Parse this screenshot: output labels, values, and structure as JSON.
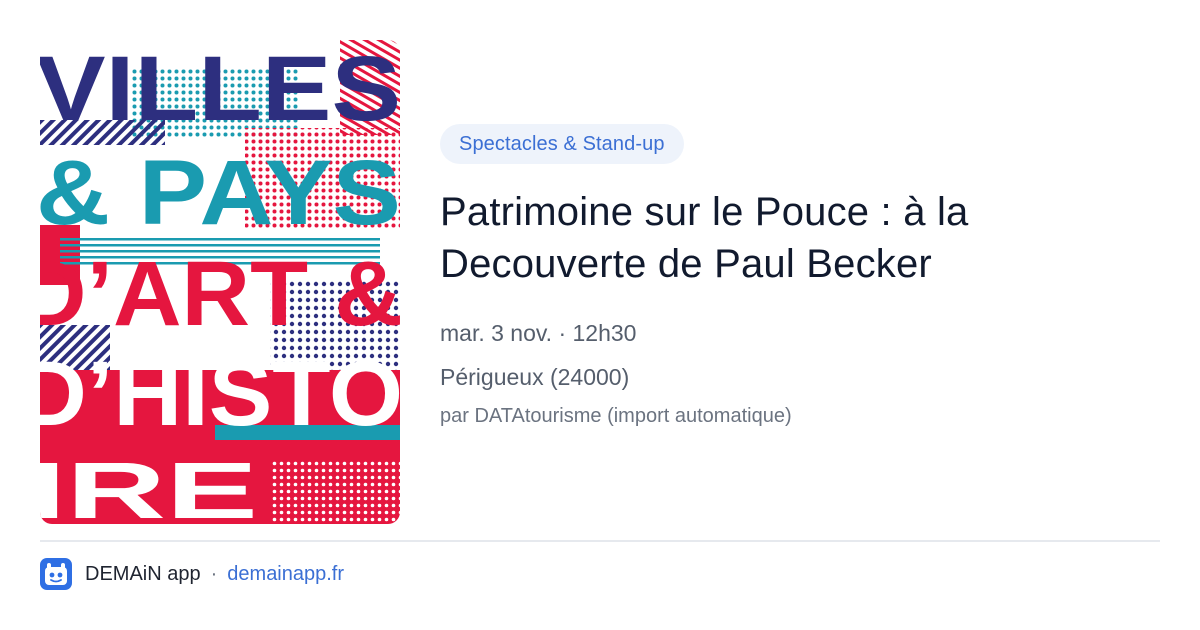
{
  "image": {
    "poster_text": [
      "VILLES",
      "& PAYS",
      "D’ART &",
      "D’HISTO",
      "IRE"
    ],
    "colors": {
      "navy": "#2d2f7f",
      "teal": "#1a9bb0",
      "red": "#e5163f",
      "white": "#ffffff"
    }
  },
  "event": {
    "category": "Spectacles & Stand-up",
    "title": "Patrimoine sur le Pouce : à la Decouverte de Paul Becker",
    "datetime": "mar. 3 nov. · 12h30",
    "location": "Périgueux (24000)",
    "source": "par DATAtourisme (import automatique)"
  },
  "footer": {
    "app_name": "DEMAiN app",
    "separator": "·",
    "site": "demainapp.fr",
    "logo_icon": "demain-logo-icon"
  },
  "colors": {
    "accent": "#3b6fd4",
    "category_bg": "#eef3fb",
    "logo_bg": "#2f6fe4"
  }
}
